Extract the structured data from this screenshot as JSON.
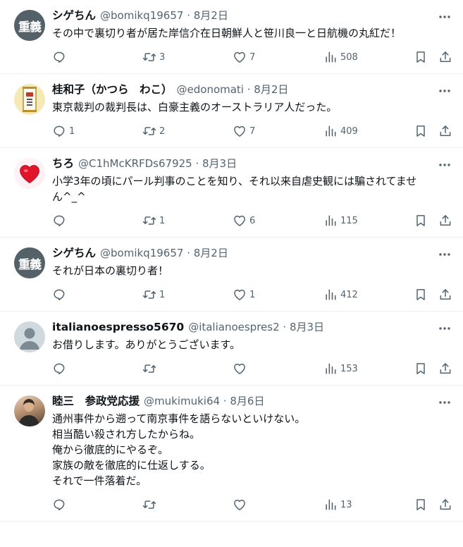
{
  "tweets": [
    {
      "avatar_text": "重義",
      "name": "シゲちん",
      "handle": "@bomikq19657",
      "date": "8月2日",
      "lines": [
        "その中で裏切り者が居た岸信介在日朝鮮人と笹川良一と日航機の丸紅だ！"
      ],
      "replies": "",
      "retweets": "3",
      "likes": "7",
      "views": "508"
    },
    {
      "avatar_text": "",
      "name": "桂和子（かつら　わこ）",
      "handle": "@edonomati",
      "date": "8月2日",
      "lines": [
        "東京裁判の裁判長は、白豪主義のオーストラリア人だった。"
      ],
      "replies": "1",
      "retweets": "2",
      "likes": "7",
      "views": "409"
    },
    {
      "avatar_text": "",
      "name": "ちろ",
      "handle": "@C1hMcKRFDs67925",
      "date": "8月3日",
      "lines": [
        "小学3年の頃にパール判事のことを知り、それ以来自虐史観には騙されてませ",
        "ん^_^"
      ],
      "replies": "",
      "retweets": "1",
      "likes": "6",
      "views": "115"
    },
    {
      "avatar_text": "重義",
      "name": "シゲちん",
      "handle": "@bomikq19657",
      "date": "8月2日",
      "lines": [
        "それが日本の裏切り者！"
      ],
      "replies": "",
      "retweets": "1",
      "likes": "1",
      "views": "412"
    },
    {
      "avatar_text": "",
      "name": "italianoespresso5670",
      "handle": "@italianoespres2",
      "date": "8月3日",
      "lines": [
        "お借りします。ありがとうございます。"
      ],
      "replies": "",
      "retweets": "",
      "likes": "",
      "views": "153"
    },
    {
      "avatar_text": "",
      "name": "睦三　参政党応援",
      "handle": "@mukimuki64",
      "date": "8月6日",
      "lines": [
        "通州事件から遡って南京事件を語らないといけない。",
        "相当酷い殺され方したからね。",
        "俺から徹底的にやるぞ。",
        "家族の敵を徹底的に仕返しする。",
        "それで一件落着だ。"
      ],
      "replies": "",
      "retweets": "",
      "likes": "",
      "views": "13"
    }
  ]
}
